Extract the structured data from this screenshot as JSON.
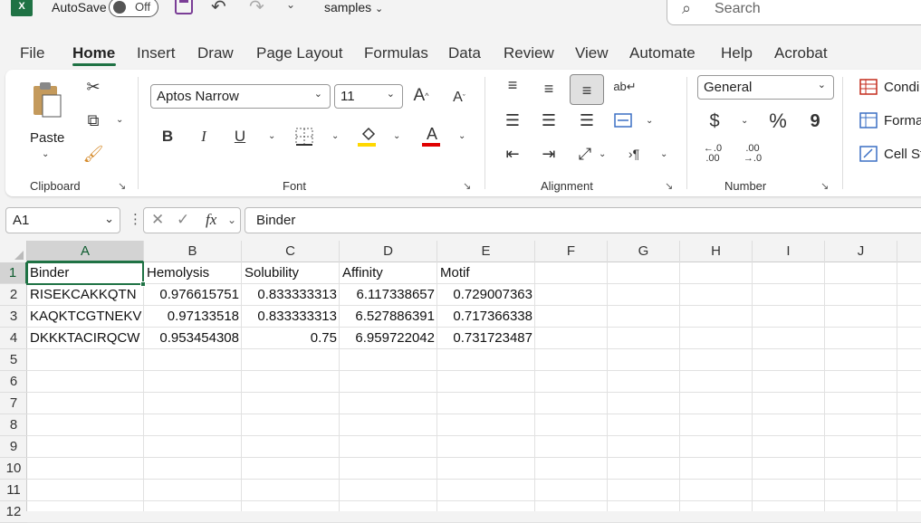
{
  "titlebar": {
    "autosave_label": "AutoSave",
    "autosave_state": "Off",
    "filename": "samples",
    "search_placeholder": "Search"
  },
  "menu": [
    "File",
    "Home",
    "Insert",
    "Draw",
    "Page Layout",
    "Formulas",
    "Data",
    "Review",
    "View",
    "Automate",
    "Help",
    "Acrobat"
  ],
  "ribbon": {
    "clipboard": {
      "paste_label": "Paste",
      "group_label": "Clipboard"
    },
    "font": {
      "font_name": "Aptos Narrow",
      "font_size": "11",
      "group_label": "Font"
    },
    "alignment": {
      "group_label": "Alignment"
    },
    "number": {
      "format": "General",
      "currency": "$",
      "percent": "%",
      "comma": "9",
      "inc_decimal": "←.0 .00",
      "dec_decimal": ".00 →.0",
      "group_label": "Number"
    },
    "styles": {
      "conditional": "Condi",
      "format_table": "Forma",
      "cell_styles": "Cell St"
    }
  },
  "formula_bar": {
    "name_box": "A1",
    "fx": "fx",
    "content": "Binder"
  },
  "grid": {
    "columns": [
      "A",
      "B",
      "C",
      "D",
      "E",
      "F",
      "G",
      "H",
      "I",
      "J"
    ],
    "rows": [
      "1",
      "2",
      "3",
      "4",
      "5",
      "6",
      "7",
      "8",
      "9",
      "10",
      "11",
      "12"
    ],
    "headers": [
      "Binder",
      "Hemolysis",
      "Solubility",
      "Affinity",
      "Motif"
    ],
    "data": [
      [
        "RISEKCAKKQTN",
        "0.976615751",
        "0.833333313",
        "6.117338657",
        "0.729007363"
      ],
      [
        "KAQKTCGTNEKV",
        "0.97133518",
        "0.833333313",
        "6.527886391",
        "0.717366338"
      ],
      [
        "DKKKTACIRQCW",
        "0.953454308",
        "0.75",
        "6.959722042",
        "0.731723487"
      ]
    ]
  },
  "colors": {
    "excel_green": "#1f7244",
    "highlight_yellow": "#ffd800",
    "font_red": "#e00000"
  }
}
